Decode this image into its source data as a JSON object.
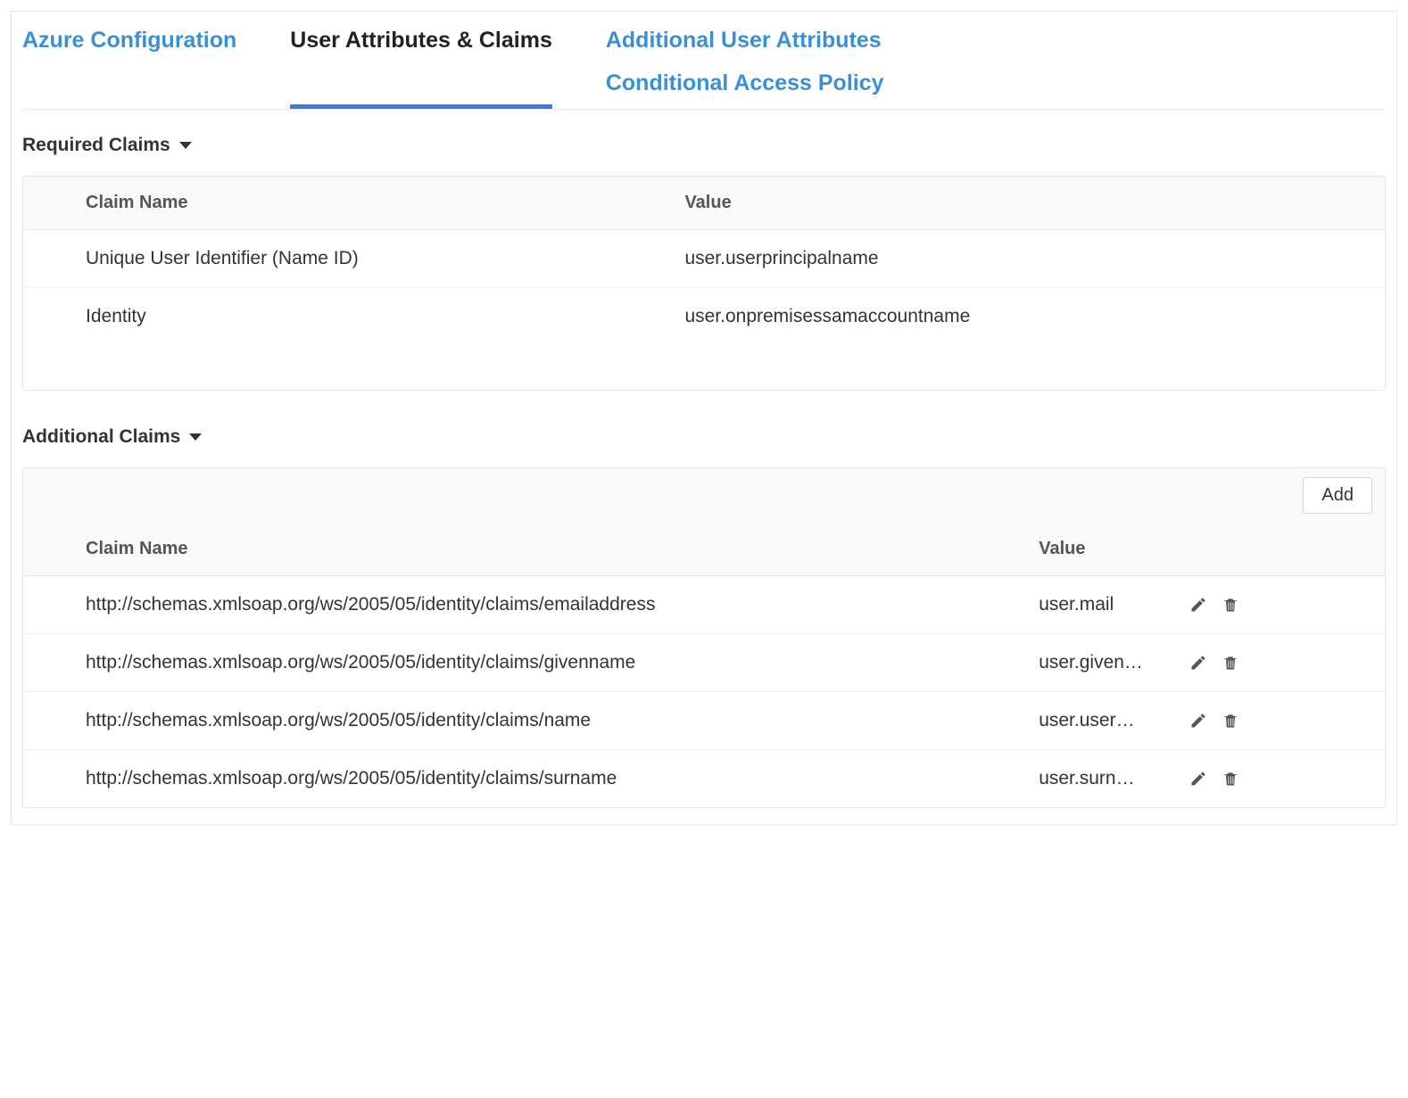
{
  "tabs": {
    "azure": "Azure Configuration",
    "attrs": "User Attributes & Claims",
    "additional_attrs": "Additional User Attributes",
    "policy": "Conditional Access Policy"
  },
  "sections": {
    "required": "Required Claims",
    "additional": "Additional Claims"
  },
  "columns": {
    "claim_name": "Claim Name",
    "value": "Value"
  },
  "buttons": {
    "add": "Add"
  },
  "required_claims": [
    {
      "name": "Unique User Identifier (Name ID)",
      "value": "user.userprincipalname"
    },
    {
      "name": "Identity",
      "value": "user.onpremisessamaccountname"
    }
  ],
  "additional_claims": [
    {
      "name": "http://schemas.xmlsoap.org/ws/2005/05/identity/claims/emailaddress",
      "value": "user.mail"
    },
    {
      "name": "http://schemas.xmlsoap.org/ws/2005/05/identity/claims/givenname",
      "value": "user.given…"
    },
    {
      "name": "http://schemas.xmlsoap.org/ws/2005/05/identity/claims/name",
      "value": "user.user…"
    },
    {
      "name": "http://schemas.xmlsoap.org/ws/2005/05/identity/claims/surname",
      "value": "user.surn…"
    }
  ]
}
